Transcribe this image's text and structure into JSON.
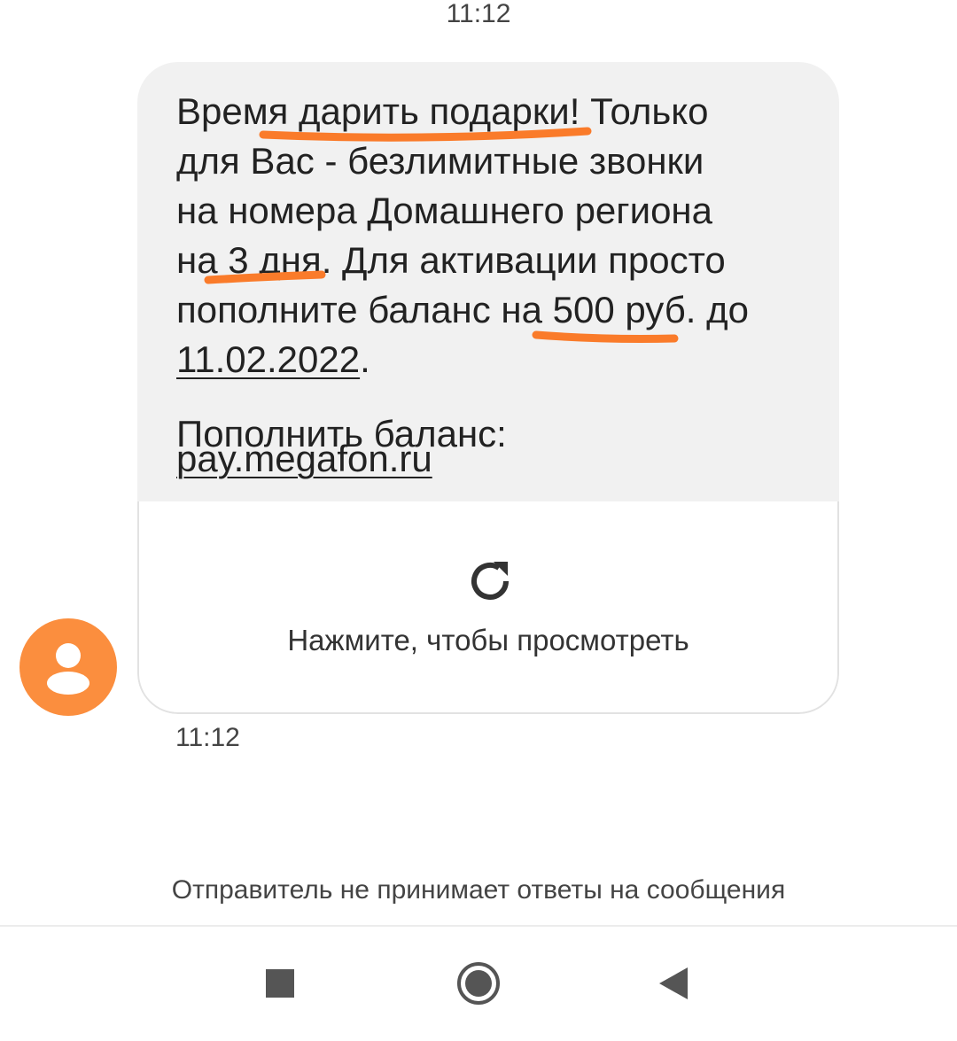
{
  "header": {
    "time": "11:12"
  },
  "message": {
    "text": "Время дарить подарки! Только\nдля Вас - безлимитные звонки\nна номера Домашнего региона\nна 3 дня. Для активации просто\nпополните баланс на 500 руб. до",
    "date_link": "11.02.2022",
    "date_suffix": ".",
    "balance_label": "Пополнить баланс:",
    "url_link": "pay.megafon.ru",
    "preview_label": "Нажмите, чтобы просмотреть",
    "time": "11:12",
    "highlight_color": "#fa7b2a"
  },
  "avatar": {
    "icon": "person-icon",
    "color": "#fb8e3e"
  },
  "footer": {
    "no_reply_notice": "Отправитель не принимает ответы на сообщения"
  },
  "navbar": {
    "recent_icon": "square-icon",
    "home_icon": "circle-icon",
    "back_icon": "triangle-back-icon"
  }
}
